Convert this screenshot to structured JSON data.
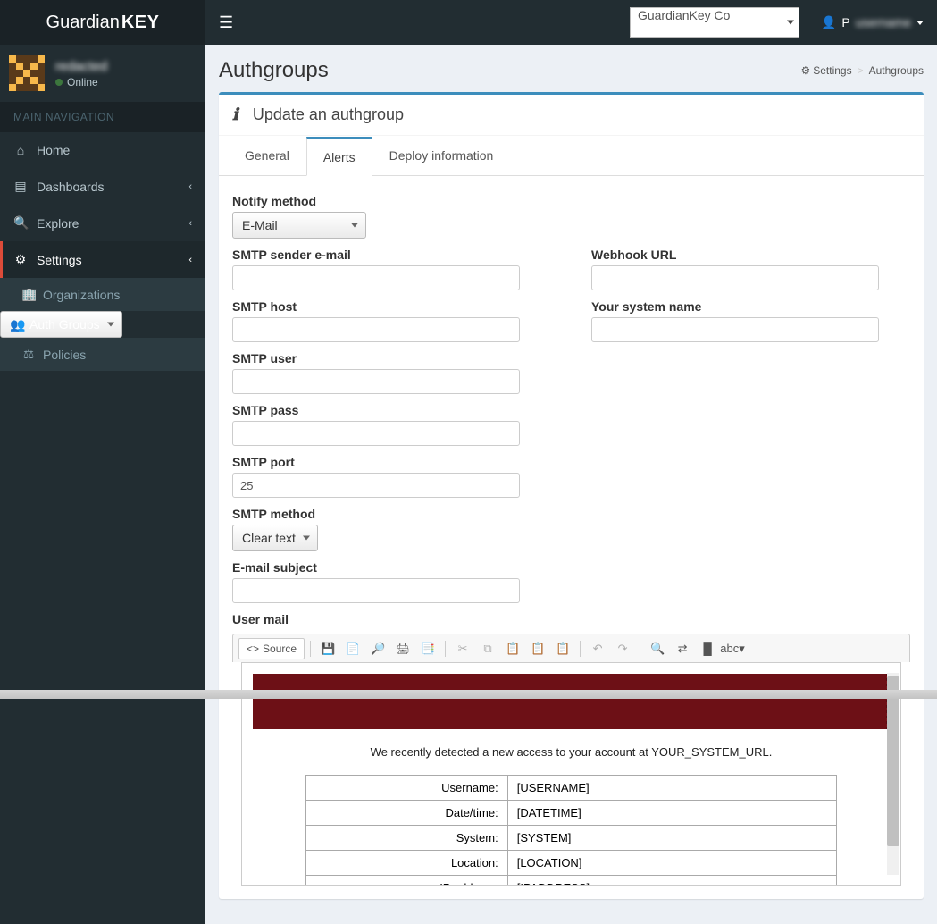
{
  "brand": {
    "first": "Guardian",
    "second": "KEY"
  },
  "header": {
    "org_selected": "GuardianKey Co",
    "user_initial": "P"
  },
  "sidebar": {
    "username": "redacted",
    "status": "Online",
    "nav_header": "MAIN NAVIGATION",
    "items": [
      {
        "label": "Home"
      },
      {
        "label": "Dashboards"
      },
      {
        "label": "Explore"
      },
      {
        "label": "Settings"
      }
    ],
    "sub_items": [
      {
        "label": "Organizations"
      },
      {
        "label": "Auth Groups"
      },
      {
        "label": "Policies"
      }
    ]
  },
  "page": {
    "title": "Authgroups",
    "breadcrumb_settings": "Settings",
    "breadcrumb_current": "Authgroups",
    "box_title": "Update an authgroup",
    "tabs": [
      {
        "label": "General"
      },
      {
        "label": "Alerts"
      },
      {
        "label": "Deploy information"
      }
    ]
  },
  "form": {
    "notify_label": "Notify method",
    "notify_value": "E-Mail",
    "smtp_sender_label": "SMTP sender e-mail",
    "smtp_sender_value": "",
    "webhook_label": "Webhook URL",
    "webhook_value": "",
    "smtp_host_label": "SMTP host",
    "smtp_host_value": "",
    "system_name_label": "Your system name",
    "system_name_value": "",
    "smtp_user_label": "SMTP user",
    "smtp_user_value": "",
    "smtp_pass_label": "SMTP pass",
    "smtp_pass_value": "",
    "smtp_port_label": "SMTP port",
    "smtp_port_value": "25",
    "smtp_method_label": "SMTP method",
    "smtp_method_value": "Clear text",
    "email_subject_label": "E-mail subject",
    "email_subject_value": "",
    "user_mail_label": "User mail"
  },
  "editor": {
    "source_label": "Source",
    "detect_text": "We recently detected a new access to your account at YOUR_SYSTEM_URL.",
    "rows": [
      {
        "k": "Username:",
        "v": "[USERNAME]"
      },
      {
        "k": "Date/time:",
        "v": "[DATETIME]"
      },
      {
        "k": "System:",
        "v": "[SYSTEM]"
      },
      {
        "k": "Location:",
        "v": "[LOCATION]"
      },
      {
        "k": "IP address:",
        "v": "[IPADDRESS]"
      }
    ]
  }
}
